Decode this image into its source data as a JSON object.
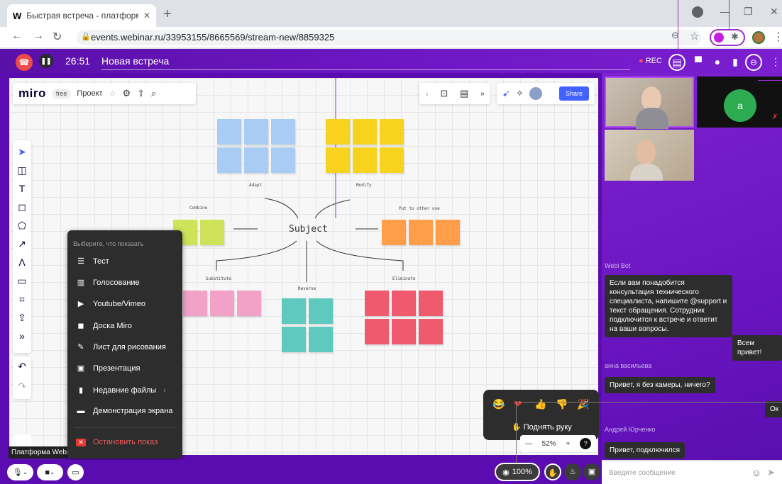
{
  "browser": {
    "tab_title": "Быстрая встреча - платформа W",
    "tab_favicon": "W",
    "url": "events.webinar.ru/33953155/8665569/stream-new/8859325"
  },
  "webinar": {
    "timer": "26:51",
    "meeting_title": "Новая встреча",
    "rec_label": "REC"
  },
  "miro": {
    "logo": "miro",
    "plan_badge": "free",
    "project": "Проект",
    "share_label": "Share"
  },
  "board": {
    "center": "Subject",
    "branches": [
      "Adapt",
      "Modify",
      "Combine",
      "Put to other use",
      "Substitute",
      "Reverse",
      "Eliminate"
    ]
  },
  "menu": {
    "header": "Выберите, что показать",
    "items": [
      {
        "label": "Тест",
        "icon": "list-icon"
      },
      {
        "label": "Голосование",
        "icon": "poll-icon"
      },
      {
        "label": "Youtube/Vimeo",
        "icon": "youtube-icon"
      },
      {
        "label": "Доска Miro",
        "icon": "miro-icon"
      },
      {
        "label": "Лист для рисования",
        "icon": "pen-icon"
      },
      {
        "label": "Презентация",
        "icon": "presentation-icon"
      },
      {
        "label": "Недавние файлы",
        "icon": "file-icon"
      },
      {
        "label": "Демонстрация экрана",
        "icon": "screen-icon"
      }
    ],
    "stop": "Остановить показ"
  },
  "tooltip": "Платформа Webinar",
  "bottom": {
    "viewers": "100%",
    "raise_hand": "Поднять руку",
    "zoom": "52%"
  },
  "participants": {
    "avatar_letter": "a"
  },
  "chat": {
    "messages": [
      {
        "author": "Webi Bot",
        "text": "Если вам понадобится консультация технического специалиста, напишите @support и текст обращения. Сотрудник подключится к встрече и ответит на ваши вопросы."
      },
      {
        "author": "",
        "text": "Всем привет!"
      },
      {
        "author": "анна васильева",
        "text": "Привет, я без камеры, ничего?"
      },
      {
        "author": "",
        "text": "Ок"
      },
      {
        "author": "Андрей Юрченко",
        "text": "Привет, подключился"
      }
    ],
    "placeholder": "Введите сообщение"
  },
  "colors": {
    "accent": "#6d16c4",
    "stop": "#f05b5b",
    "share": "#4262ff"
  }
}
